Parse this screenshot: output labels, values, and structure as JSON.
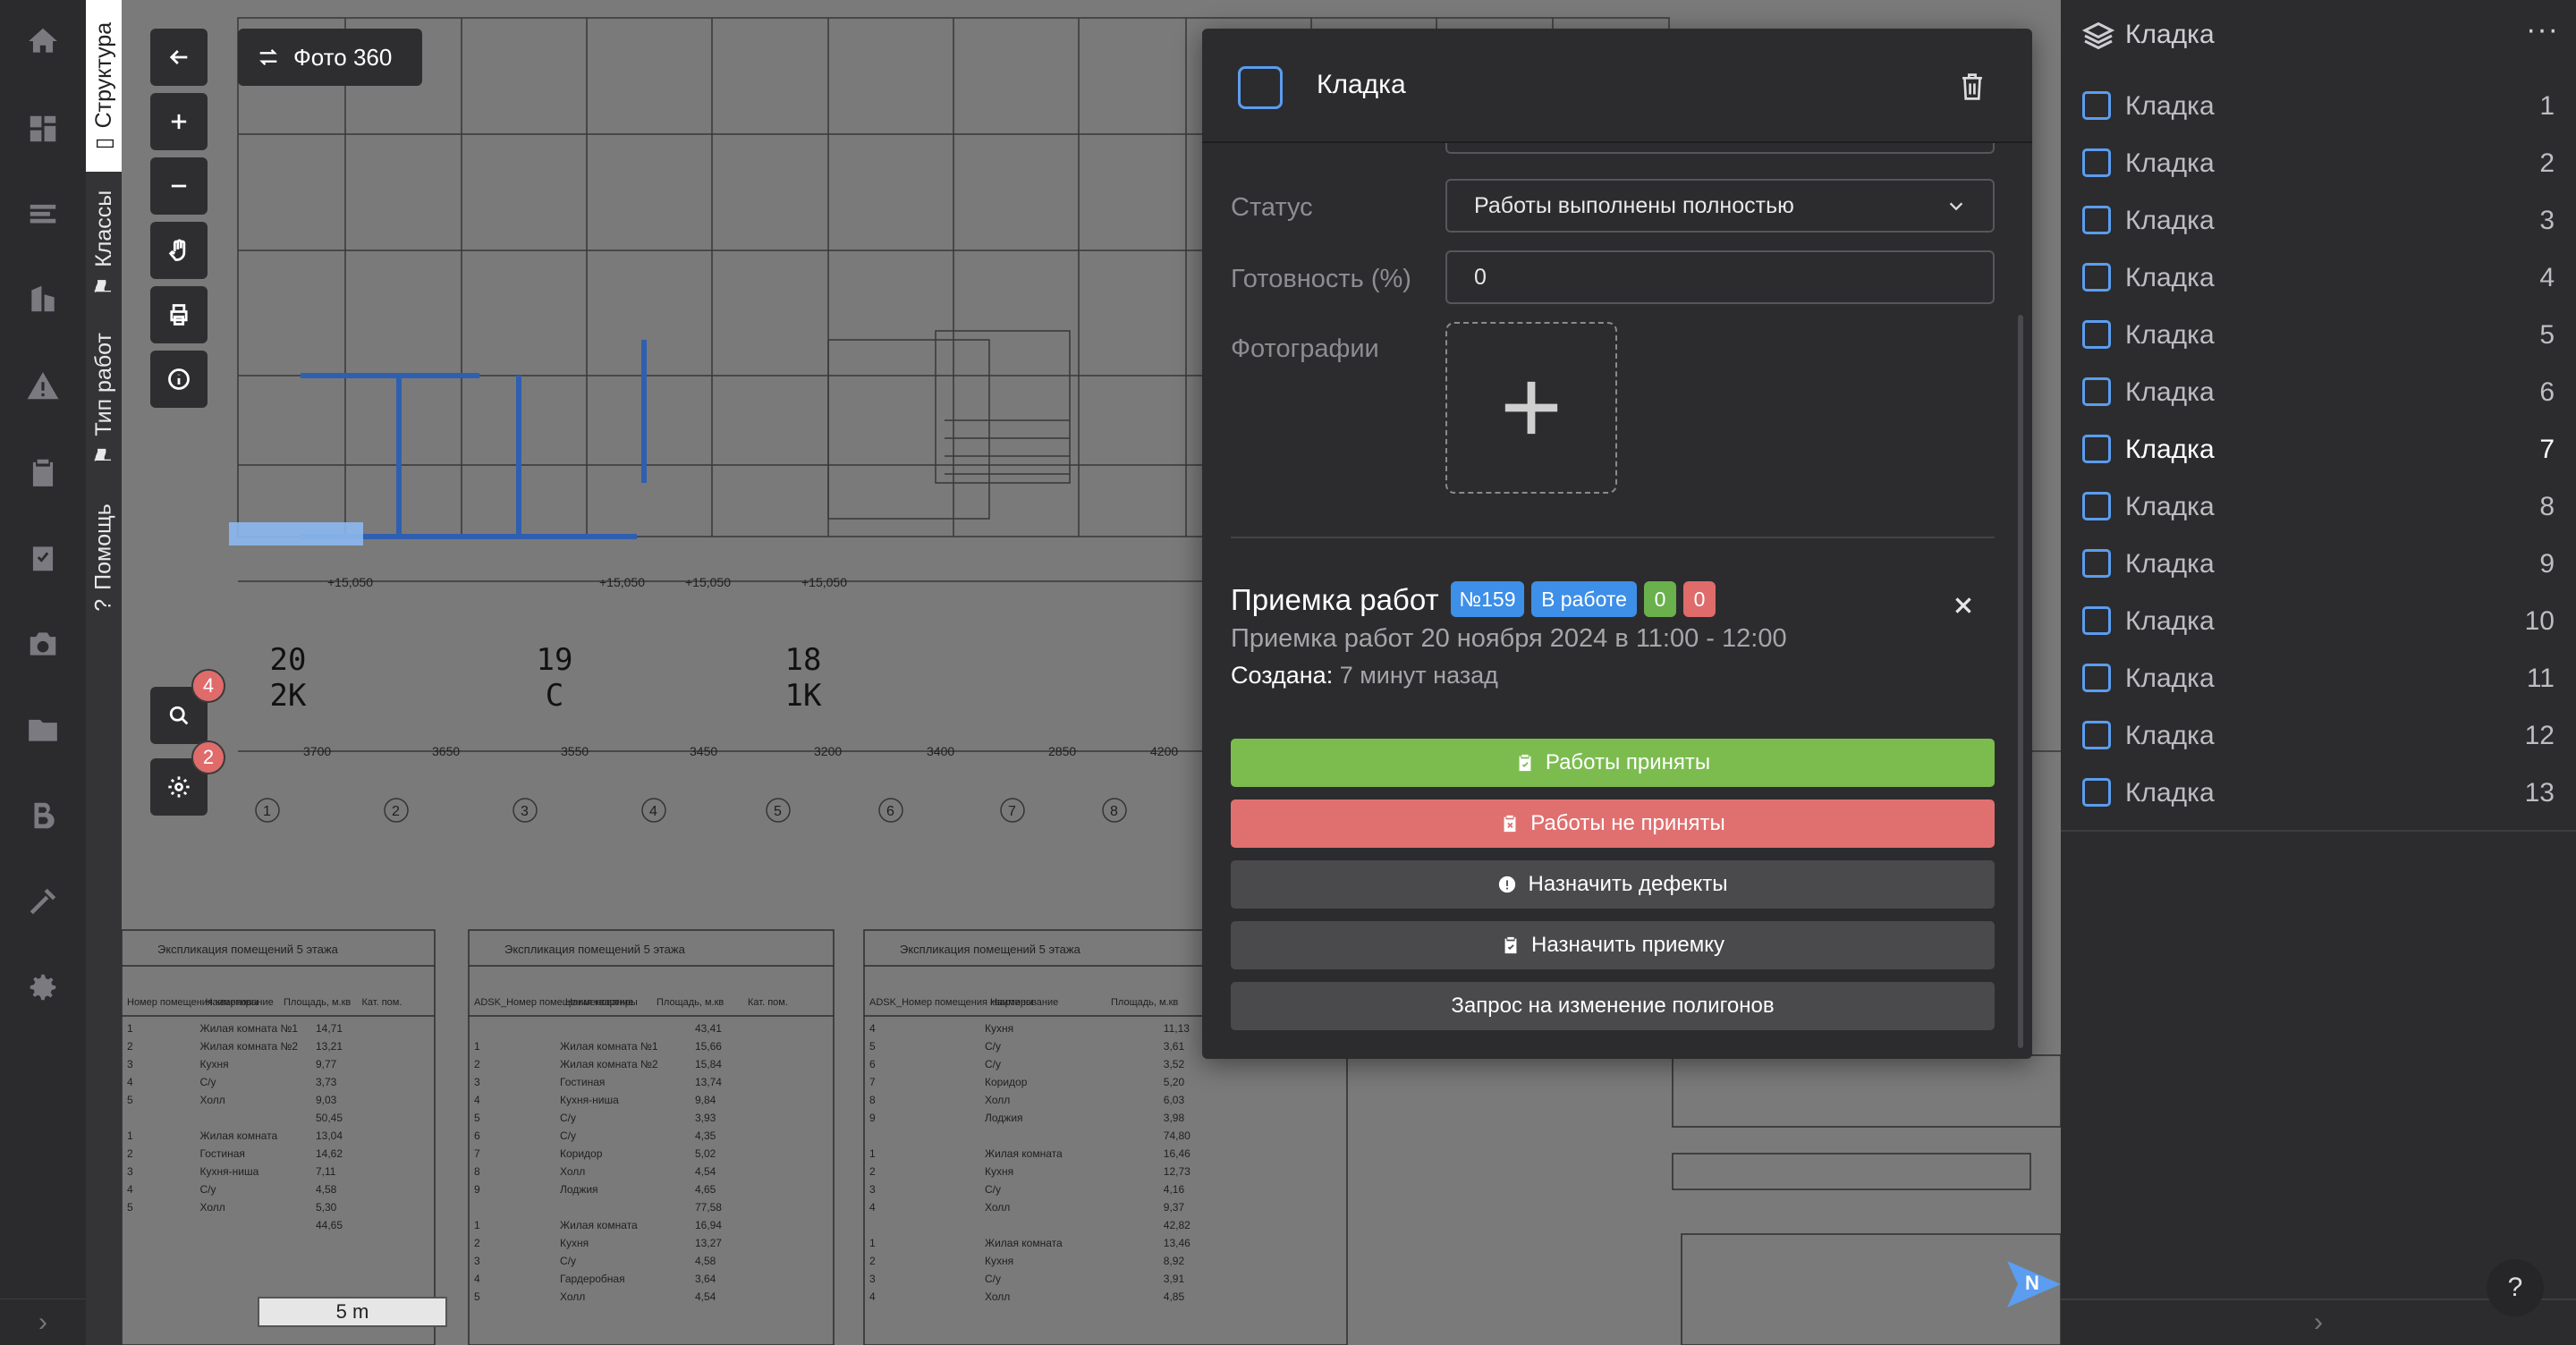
{
  "vertical_tabs": {
    "structure": "Структура",
    "classes": "Классы",
    "work_type": "Тип работ",
    "help": "Помощь"
  },
  "toolbar": {
    "photo360_label": "Фото 360",
    "search_badge": "4",
    "settings_badge": "2"
  },
  "plan": {
    "units": [
      {
        "number": "20",
        "type": "2K"
      },
      {
        "number": "19",
        "type": "C"
      },
      {
        "number": "18",
        "type": "1K"
      }
    ],
    "scale_label": "5 m",
    "north_label": "N",
    "axis_dims": [
      "3700",
      "3650",
      "3550",
      "3450",
      "3200",
      "3400",
      "2850",
      "4200"
    ],
    "axis_numbers": [
      "1",
      "2",
      "3",
      "4",
      "5",
      "6",
      "7",
      "8"
    ],
    "levels": [
      "+15,050",
      "+15,050",
      "+15,050",
      "+15,050"
    ],
    "tables": [
      {
        "title": "Экспликация помещений 5 этажа",
        "headers": [
          "Номер помещения квартиры",
          "Наименование",
          "Площадь, м.кв",
          "Кат. пом."
        ],
        "rows": [
          [
            "1",
            "Жилая комната №1",
            "14,71"
          ],
          [
            "2",
            "Жилая комната №2",
            "13,21"
          ],
          [
            "3",
            "Кухня",
            "9,77"
          ],
          [
            "4",
            "С/у",
            "3,73"
          ],
          [
            "5",
            "Холл",
            "9,03"
          ],
          [
            "",
            "",
            "50,45"
          ],
          [
            "1",
            "Жилая комната",
            "13,04"
          ],
          [
            "2",
            "Гостиная",
            "14,62"
          ],
          [
            "3",
            "Кухня-ниша",
            "7,11"
          ],
          [
            "4",
            "С/у",
            "4,58"
          ],
          [
            "5",
            "Холл",
            "5,30"
          ],
          [
            "",
            "",
            "44,65"
          ]
        ]
      },
      {
        "title": "Экспликация помещений 5 этажа",
        "headers": [
          "ADSK_Номер помещения квартиры",
          "Наименование",
          "Площадь, м.кв",
          "Кат. пом."
        ],
        "rows": [
          [
            "",
            "",
            "43,41"
          ],
          [
            "1",
            "Жилая комната №1",
            "15,66"
          ],
          [
            "2",
            "Жилая комната №2",
            "15,84"
          ],
          [
            "3",
            "Гостиная",
            "13,74"
          ],
          [
            "4",
            "Кухня-ниша",
            "9,84"
          ],
          [
            "5",
            "С/у",
            "3,93"
          ],
          [
            "6",
            "С/у",
            "4,35"
          ],
          [
            "7",
            "Коридор",
            "5,02"
          ],
          [
            "8",
            "Холл",
            "4,54"
          ],
          [
            "9",
            "Лоджия",
            "4,65"
          ],
          [
            "",
            "",
            "77,58"
          ],
          [
            "1",
            "Жилая комната",
            "16,94"
          ],
          [
            "2",
            "Кухня",
            "13,27"
          ],
          [
            "3",
            "С/у",
            "4,58"
          ],
          [
            "4",
            "Гардеробная",
            "3,64"
          ],
          [
            "5",
            "Холл",
            "4,54"
          ]
        ]
      },
      {
        "title": "Экспликация помещений 5 этажа",
        "headers": [
          "ADSK_Номер помещения квартиры",
          "Наименование",
          "Площадь, м.кв",
          "Кат. пом."
        ],
        "rows": [
          [
            "4",
            "Кухня",
            "11,13"
          ],
          [
            "5",
            "С/у",
            "3,61"
          ],
          [
            "6",
            "С/у",
            "3,52"
          ],
          [
            "7",
            "Коридор",
            "5,20"
          ],
          [
            "8",
            "Холл",
            "6,03"
          ],
          [
            "9",
            "Лоджия",
            "3,98"
          ],
          [
            "",
            "",
            "74,80"
          ],
          [
            "1",
            "Жилая комната",
            "16,46"
          ],
          [
            "2",
            "Кухня",
            "12,73"
          ],
          [
            "3",
            "С/у",
            "4,16"
          ],
          [
            "4",
            "Холл",
            "9,37"
          ],
          [
            "",
            "",
            "42,82"
          ],
          [
            "1",
            "Жилая комната",
            "13,46"
          ],
          [
            "2",
            "Кухня",
            "8,92"
          ],
          [
            "3",
            "С/у",
            "3,91"
          ],
          [
            "4",
            "Холл",
            "4,85"
          ]
        ]
      }
    ]
  },
  "panel": {
    "title": "Кладка",
    "status_label": "Статус",
    "status_value": "Работы выполнены полностью",
    "readiness_label": "Готовность (%)",
    "readiness_value": "0",
    "photos_label": "Фотографии",
    "acceptance": {
      "title": "Приемка работ",
      "number_tag": "№159",
      "state_tag": "В работе",
      "green_count": "0",
      "red_count": "0",
      "subtitle": "Приемка работ 20 ноября 2024 в 11:00 - 12:00",
      "created_label": "Создана:",
      "created_value": "7 минут назад"
    },
    "actions": {
      "accepted": "Работы приняты",
      "not_accepted": "Работы не приняты",
      "assign_defects": "Назначить дефекты",
      "assign_acceptance": "Назначить приемку",
      "polygon_request": "Запрос на изменение полигонов"
    },
    "colors": {
      "accepted": "#7cbc4f",
      "not_accepted": "#e07070",
      "neutral": "#4a4a4c",
      "tag_blue": "#3d8fe8",
      "tag_green": "#6ab04c",
      "tag_red": "#e06b6b"
    }
  },
  "sidebar": {
    "title": "Кладка",
    "more": "···",
    "items": [
      {
        "label": "Кладка",
        "num": "1"
      },
      {
        "label": "Кладка",
        "num": "2"
      },
      {
        "label": "Кладка",
        "num": "3"
      },
      {
        "label": "Кладка",
        "num": "4"
      },
      {
        "label": "Кладка",
        "num": "5"
      },
      {
        "label": "Кладка",
        "num": "6"
      },
      {
        "label": "Кладка",
        "num": "7"
      },
      {
        "label": "Кладка",
        "num": "8"
      },
      {
        "label": "Кладка",
        "num": "9"
      },
      {
        "label": "Кладка",
        "num": "10"
      },
      {
        "label": "Кладка",
        "num": "11"
      },
      {
        "label": "Кладка",
        "num": "12"
      },
      {
        "label": "Кладка",
        "num": "13"
      }
    ]
  },
  "help_button": "?"
}
